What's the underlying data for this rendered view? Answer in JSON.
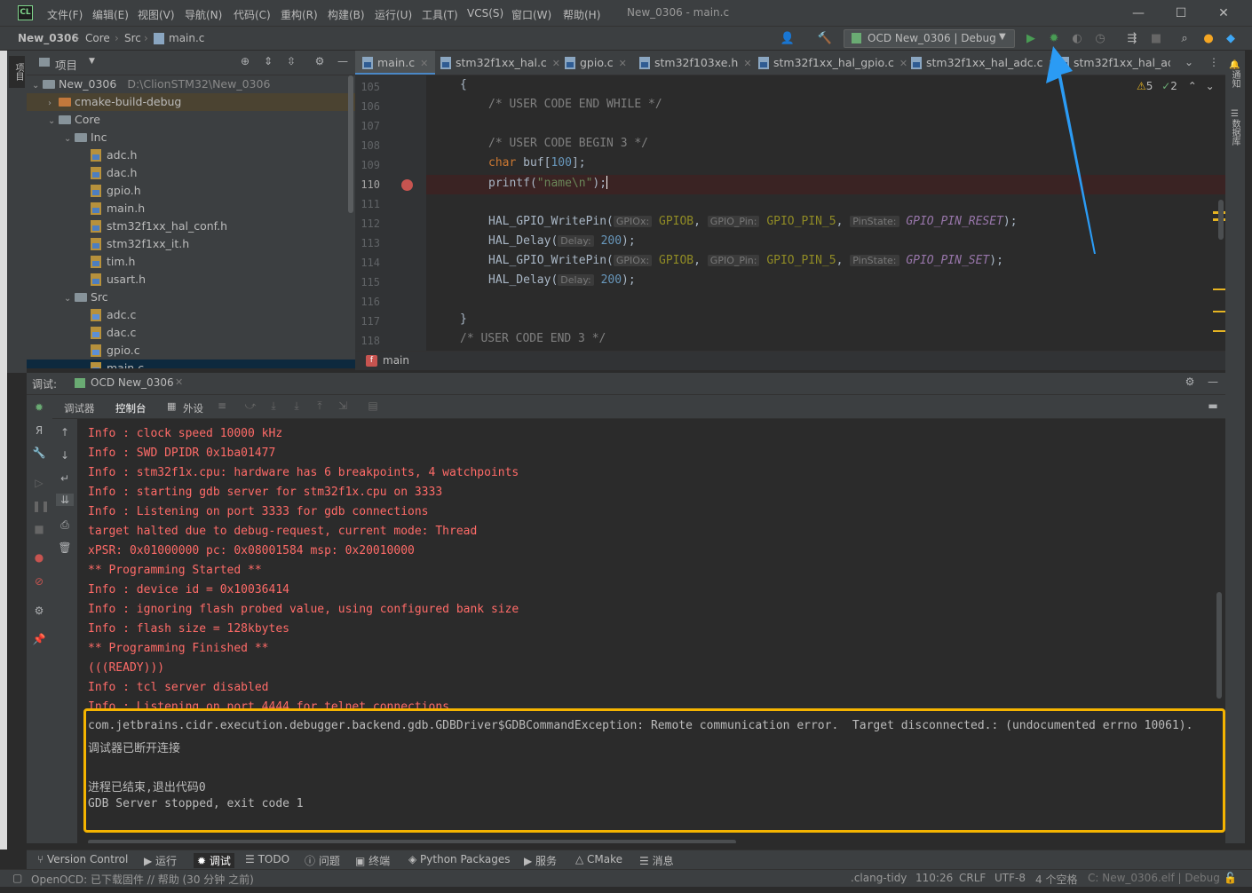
{
  "app_logo": "CL",
  "menu": [
    "文件(F)",
    "编辑(E)",
    "视图(V)",
    "导航(N)",
    "代码(C)",
    "重构(R)",
    "构建(B)",
    "运行(U)",
    "工具(T)",
    "VCS(S)",
    "窗口(W)",
    "帮助(H)"
  ],
  "window_title": "New_0306 - main.c",
  "breadcrumb": [
    "New_0306",
    "Core",
    "Src",
    "main.c"
  ],
  "run_config": "OCD New_0306 | Debug",
  "project_panel": {
    "title": "项目",
    "root": {
      "name": "New_0306",
      "path": "D:\\ClionSTM32\\New_0306"
    },
    "items": [
      {
        "label": "cmake-build-debug",
        "type": "folder-orange",
        "level": 1,
        "arrow": "›"
      },
      {
        "label": "Core",
        "type": "folder",
        "level": 1,
        "arrow": "⌄"
      },
      {
        "label": "Inc",
        "type": "folder",
        "level": 2,
        "arrow": "⌄"
      },
      {
        "label": "adc.h",
        "type": "h",
        "level": 3
      },
      {
        "label": "dac.h",
        "type": "h",
        "level": 3
      },
      {
        "label": "gpio.h",
        "type": "h",
        "level": 3
      },
      {
        "label": "main.h",
        "type": "h",
        "level": 3
      },
      {
        "label": "stm32f1xx_hal_conf.h",
        "type": "h",
        "level": 3
      },
      {
        "label": "stm32f1xx_it.h",
        "type": "h",
        "level": 3
      },
      {
        "label": "tim.h",
        "type": "h",
        "level": 3
      },
      {
        "label": "usart.h",
        "type": "h",
        "level": 3
      },
      {
        "label": "Src",
        "type": "folder",
        "level": 2,
        "arrow": "⌄"
      },
      {
        "label": "adc.c",
        "type": "c",
        "level": 3
      },
      {
        "label": "dac.c",
        "type": "c",
        "level": 3
      },
      {
        "label": "gpio.c",
        "type": "c",
        "level": 3
      },
      {
        "label": "main.c",
        "type": "c",
        "level": 3
      }
    ]
  },
  "editor_tabs": [
    "main.c",
    "stm32f1xx_hal.c",
    "gpio.c",
    "stm32f103xe.h",
    "stm32f1xx_hal_gpio.c",
    "stm32f1xx_hal_adc.c",
    "stm32f1xx_hal_adc.h"
  ],
  "inspections": {
    "warnings": "5",
    "weak": "2"
  },
  "code": {
    "line_numbers": [
      "105",
      "106",
      "107",
      "108",
      "109",
      "110",
      "111",
      "112",
      "113",
      "114",
      "115",
      "116",
      "117",
      "118"
    ],
    "current_line": "110",
    "breakpoint_line": "110",
    "l105": "{",
    "l106": "/* USER CODE END WHILE */",
    "l108": "/* USER CODE BEGIN 3 */",
    "l109_kw": "char",
    "l109_a": " buf[",
    "l109_num": "100",
    "l109_b": "];",
    "l110_fn": "printf(",
    "l110_str": "\"name\\n\"",
    "l110_end": ");",
    "l112_fn": "HAL_GPIO_WritePin(",
    "l113_fn": "HAL_Delay(",
    "hint_gpiox": "GPIOx:",
    "hint_pin": "GPIO_Pin:",
    "hint_state": "PinState:",
    "hint_delay": "Delay:",
    "gpiob": "GPIOB",
    "pin5": "GPIO_PIN_5",
    "reset": "GPIO_PIN_RESET",
    "set": "GPIO_PIN_SET",
    "delay_val": "200",
    "l117": "}",
    "l118": "/* USER CODE END 3 */"
  },
  "function_crumb": "main",
  "debug": {
    "label": "调试:",
    "session": "OCD New_0306",
    "tabs": [
      "调试器",
      "控制台",
      "外设"
    ],
    "console_red": [
      "Info : clock speed 10000 kHz",
      "Info : SWD DPIDR 0x1ba01477",
      "Info : stm32f1x.cpu: hardware has 6 breakpoints, 4 watchpoints",
      "Info : starting gdb server for stm32f1x.cpu on 3333",
      "Info : Listening on port 3333 for gdb connections",
      "target halted due to debug-request, current mode: Thread",
      "xPSR: 0x01000000 pc: 0x08001584 msp: 0x20010000",
      "** Programming Started **",
      "Info : device id = 0x10036414",
      "Info : ignoring flash probed value, using configured bank size",
      "Info : flash size = 128kbytes",
      "** Programming Finished **",
      "(((READY)))",
      "Info : tcl server disabled",
      "Info : Listening on port 4444 for telnet connections"
    ],
    "console_error": [
      "com.jetbrains.cidr.execution.debugger.backend.gdb.GDBDriver$GDBCommandException: Remote communication error.  Target disconnected.: (undocumented errno 10061).",
      "调试器已断开连接",
      "",
      "进程已结束,退出代码0",
      "GDB Server stopped, exit code 1"
    ]
  },
  "tool_windows": [
    "Version Control",
    "运行",
    "调试",
    "TODO",
    "问题",
    "终端",
    "Python Packages",
    "服务",
    "CMake",
    "消息"
  ],
  "status": {
    "message": "OpenOCD: 已下载固件 // 帮助 (30 分钟 之前)",
    "linter": ".clang-tidy",
    "position": "110:26",
    "line_sep": "CRLF",
    "encoding": "UTF-8",
    "indent": "4 个空格",
    "context": "C: New_0306.elf | Debug"
  },
  "side_labels": {
    "project": "项目",
    "notifications": "通知",
    "database": "数据库",
    "structure": "结构",
    "bookmarks": "书签"
  },
  "colors": {
    "accent": "#4a88c7",
    "error_highlight": "#f5b400",
    "console_error": "#ff6b68",
    "annotation_arrow": "#2b9bf4"
  }
}
